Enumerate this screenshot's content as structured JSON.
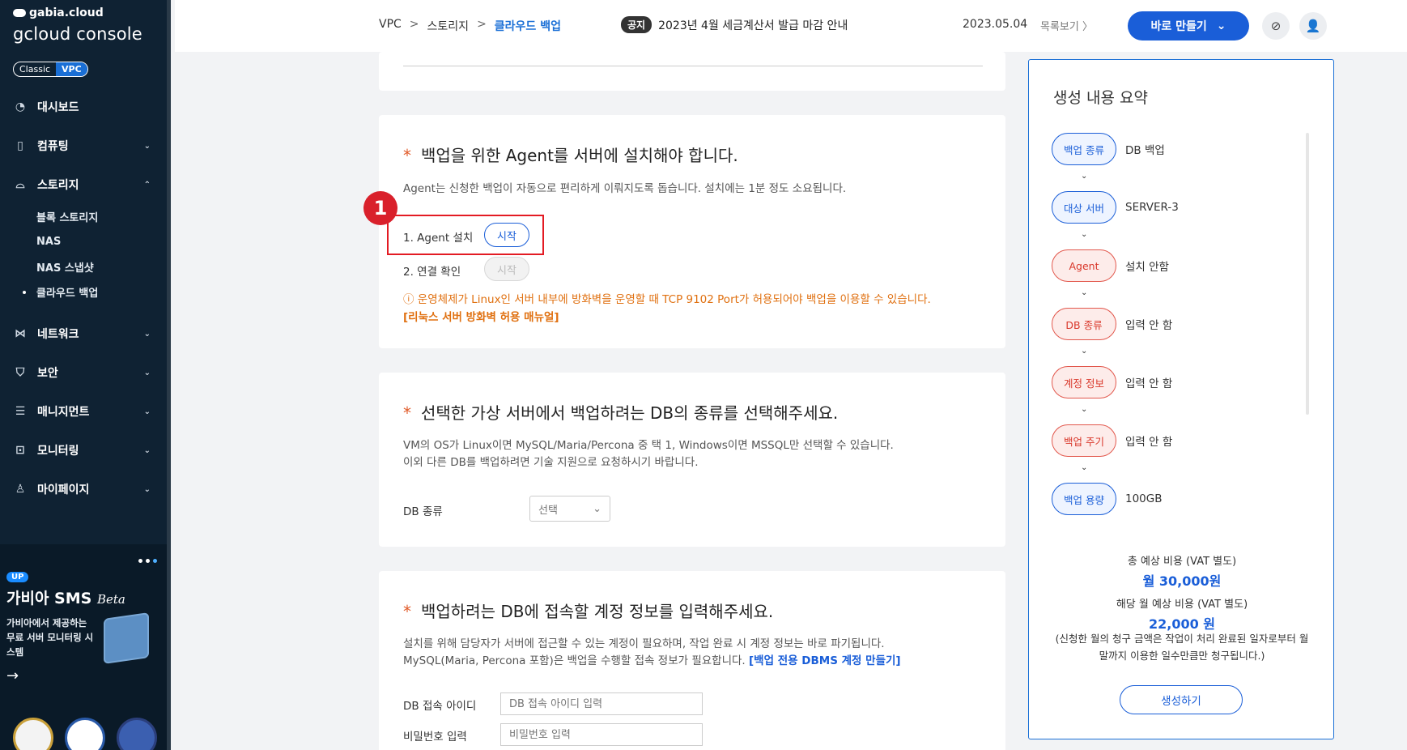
{
  "sidebar": {
    "brand_top": "gabia.cloud",
    "brand_main": "gcloud console",
    "mode": {
      "classic": "Classic",
      "vpc": "VPC"
    },
    "nav": [
      {
        "label": "대시보드",
        "icon": "dashboard-icon"
      },
      {
        "label": "컴퓨팅",
        "icon": "chip-icon"
      },
      {
        "label": "스토리지",
        "icon": "storage-icon"
      },
      {
        "label": "네트워크",
        "icon": "network-icon"
      },
      {
        "label": "보안",
        "icon": "shield-icon"
      },
      {
        "label": "매니지먼트",
        "icon": "management-icon"
      },
      {
        "label": "모니터링",
        "icon": "monitoring-icon"
      },
      {
        "label": "마이페이지",
        "icon": "user-icon"
      }
    ],
    "storage_sub": [
      "블록 스토리지",
      "NAS",
      "NAS 스냅샷",
      "클라우드 백업"
    ],
    "promo": {
      "badge": "UP",
      "title": "가비아 SMS",
      "title_suffix": "Beta",
      "desc": "가비아에서 제공하는 무료 서버 모니터링 시스템",
      "arrow": "→"
    }
  },
  "header": {
    "breadcrumb": [
      "VPC",
      "스토리지",
      "클라우드 백업"
    ],
    "breadcrumb_sep": ">",
    "notice_tag": "공지",
    "notice_text": "2023년 4월 세금계산서 발급 마감 안내",
    "notice_date": "2023.05.04",
    "notice_more": "목록보기 〉",
    "make_button": "바로 만들기",
    "make_chevron": "⌄",
    "chat_icon": "⊘",
    "user_icon": "👤"
  },
  "agent": {
    "star": "*",
    "title": "백업을 위한 Agent를 서버에 설치해야 합니다.",
    "desc": "Agent는 신청한 백업이 자동으로 편리하게 이뤄지도록 돕습니다. 설치에는 1분 정도 소요됩니다.",
    "marker": "1",
    "step1_label": "1. Agent 설치",
    "step1_button": "시작",
    "step2_label": "2. 연결 확인",
    "step2_button": "시작",
    "warning": "ⓘ 운영체제가 Linux인 서버 내부에 방화벽을 운영할 때 TCP 9102 Port가 허용되어야 백업을 이용할 수 있습니다.",
    "warning_link": "[리눅스 서버 방화벽 허용 매뉴얼]"
  },
  "db_type": {
    "star": "*",
    "title": "선택한 가상 서버에서 백업하려는 DB의 종류를 선택해주세요.",
    "desc1": "VM의 OS가 Linux이면 MySQL/Maria/Percona 중 택 1, Windows이면 MSSQL만 선택할 수 있습니다.",
    "desc2": "이외 다른 DB를 백업하려면 기술 지원으로 요청하시기 바랍니다.",
    "label": "DB 종류",
    "select_value": "선택",
    "select_chevron": "⌄"
  },
  "account": {
    "star": "*",
    "title": "백업하려는 DB에 접속할 계정 정보를 입력해주세요.",
    "desc1": "설치를 위해 담당자가 서버에 접근할 수 있는 계정이 필요하며, 작업 완료 시 계정 정보는 바로 파기됩니다.",
    "desc2": "MySQL(Maria, Percona 포함)은 백업을 수행할 접속 정보가 필요합니다.",
    "desc2_link": "[백업 전용 DBMS 계정 만들기]",
    "id_label": "DB 접속 아이디",
    "id_placeholder": "DB 접속 아이디 입력",
    "pw_label": "비밀번호 입력",
    "pw_placeholder": "비밀번호 입력"
  },
  "summary": {
    "title": "생성 내용 요약",
    "arrow": "⌄",
    "rows": [
      {
        "key": "백업 종류",
        "value": "DB 백업",
        "state": "done"
      },
      {
        "key": "대상 서버",
        "value": "SERVER-3",
        "state": "done"
      },
      {
        "key": "Agent",
        "value": "설치 안함",
        "state": "pending"
      },
      {
        "key": "DB 종류",
        "value": "입력 안 함",
        "state": "pending"
      },
      {
        "key": "계정 정보",
        "value": "입력 안 함",
        "state": "pending"
      },
      {
        "key": "백업 주기",
        "value": "입력 안 함",
        "state": "pending"
      },
      {
        "key": "백업 용량",
        "value": "100GB",
        "state": "done"
      }
    ],
    "total_label": "총 예상 비용 (VAT 별도)",
    "total_value": "월 30,000원",
    "month_label": "해당 월 예상 비용 (VAT 별도)",
    "month_value": "22,000 원",
    "note": "(신청한 월의 청구 금액은 작업이 처리 완료된 일자로부터 월말까지 이용한 일수만큼만 청구됩니다.)",
    "create_button": "생성하기"
  },
  "colors": {
    "accent": "#1a5ed8",
    "sidebar": "#0f2233",
    "warning": "#e07010",
    "highlight": "#e31b23"
  }
}
